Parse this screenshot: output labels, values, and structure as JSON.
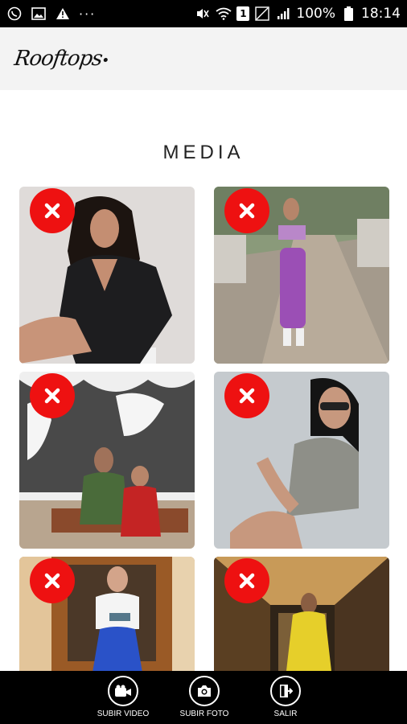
{
  "status_bar": {
    "battery_percent": "100%",
    "time": "18:14",
    "sim_badge": "1",
    "more": "···"
  },
  "header": {
    "logo_text": "Rooftops"
  },
  "section": {
    "title": "MEDIA"
  },
  "media": {
    "items": [
      {
        "id": "photo-1",
        "delete_icon": "close-icon"
      },
      {
        "id": "photo-2",
        "delete_icon": "close-icon"
      },
      {
        "id": "photo-3",
        "delete_icon": "close-icon"
      },
      {
        "id": "photo-4",
        "delete_icon": "close-icon"
      },
      {
        "id": "photo-5",
        "delete_icon": "close-icon"
      },
      {
        "id": "photo-6",
        "delete_icon": "close-icon"
      }
    ]
  },
  "bottom_bar": {
    "upload_video_label": "SUBIR VIDEO",
    "upload_photo_label": "SUBIR FOTO",
    "exit_label": "SALIR"
  },
  "colors": {
    "delete_red": "#ee1111",
    "header_bg": "#f3f3f3",
    "bar_bg": "#000000"
  }
}
